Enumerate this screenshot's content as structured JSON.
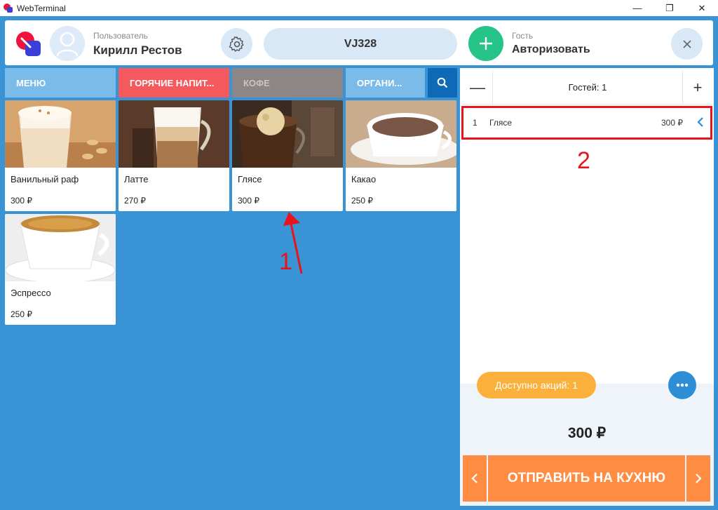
{
  "window": {
    "title": "WebTerminal",
    "min": "—",
    "max": "❐",
    "close": "✕"
  },
  "header": {
    "user_caption": "Пользователь",
    "user_name": "Кирилл Рестов",
    "order_code": "VJ328",
    "guest_caption": "Гость",
    "guest_action": "Авторизовать"
  },
  "tabs": [
    {
      "label": "МЕНЮ"
    },
    {
      "label": "ГОРЯЧИЕ НАПИТ..."
    },
    {
      "label": "КОФЕ"
    },
    {
      "label": "ОРГАНИ..."
    }
  ],
  "products": [
    {
      "name": "Ванильный раф",
      "price": "300 ₽"
    },
    {
      "name": "Латте",
      "price": "270 ₽"
    },
    {
      "name": "Глясе",
      "price": "300 ₽"
    },
    {
      "name": "Какао",
      "price": "250 ₽"
    },
    {
      "name": "Эспрессо",
      "price": "250 ₽"
    }
  ],
  "order": {
    "guests_label": "Гостей: 1",
    "minus": "—",
    "plus": "+",
    "lines": [
      {
        "qty": "1",
        "name": "Глясе",
        "price": "300 ₽"
      }
    ],
    "promo_label": "Доступно акций: 1",
    "total": "300 ₽",
    "send_label": "ОТПРАВИТЬ НА КУХНЮ"
  },
  "annotations": {
    "marker_1": "1",
    "marker_2": "2"
  },
  "colors": {
    "background": "#3a93d4",
    "tab_menu": "#7bbbe9",
    "tab_hot": "#f45a5d",
    "tab_coffee": "#8d8687",
    "accent_green": "#27c48a",
    "send_orange": "#ff8c43",
    "promo_yellow": "#fbb03b",
    "annotation_red": "#e8141c"
  }
}
